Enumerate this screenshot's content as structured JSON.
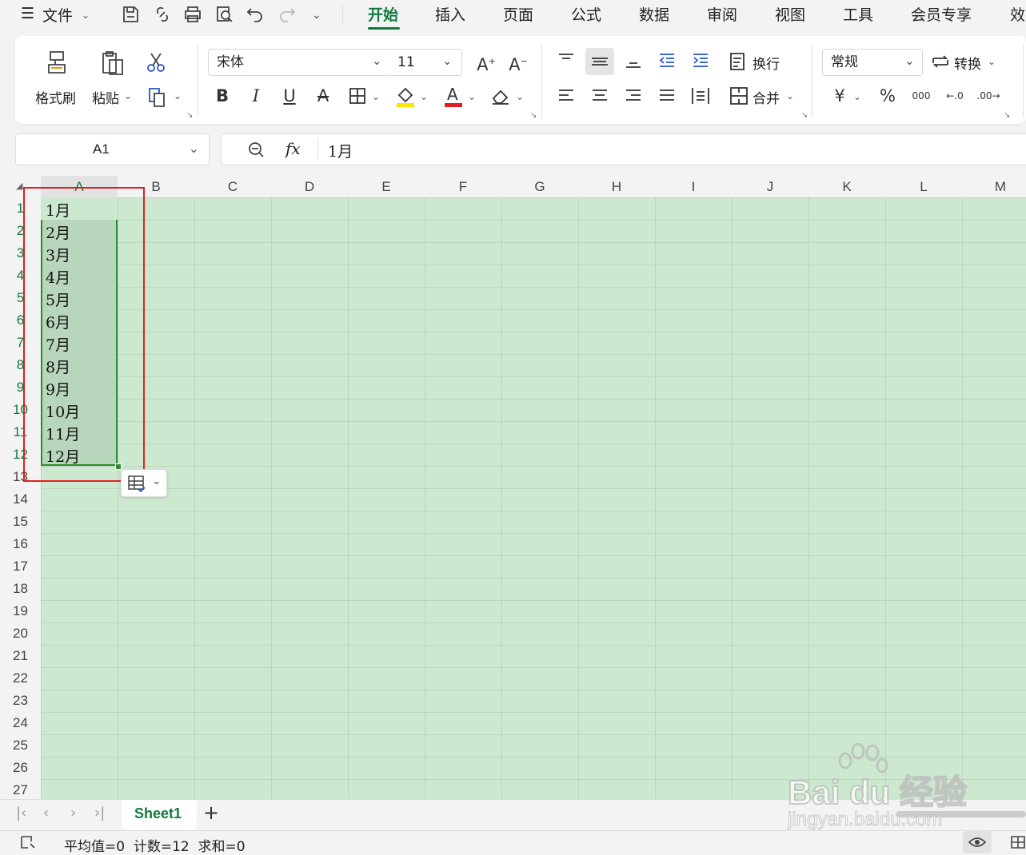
{
  "menubar": {
    "file_label": "文件",
    "tabs": [
      "开始",
      "插入",
      "页面",
      "公式",
      "数据",
      "审阅",
      "视图",
      "工具",
      "会员专享",
      "效"
    ]
  },
  "ribbon": {
    "format_painter": "格式刷",
    "paste": "粘贴",
    "font_name": "宋体",
    "font_size": "11",
    "wrap": "换行",
    "merge": "合并",
    "number_format": "常规",
    "convert": "转换"
  },
  "formula_bar": {
    "name_box": "A1",
    "fx": "fx",
    "content": "1月"
  },
  "grid": {
    "columns": [
      "A",
      "B",
      "C",
      "D",
      "E",
      "F",
      "G",
      "H",
      "I",
      "J",
      "K",
      "L",
      "M"
    ],
    "rows": [
      "1",
      "2",
      "3",
      "4",
      "5",
      "6",
      "7",
      "8",
      "9",
      "10",
      "11",
      "12",
      "13",
      "14",
      "15",
      "16",
      "17",
      "18",
      "19",
      "20",
      "21",
      "22",
      "23",
      "24",
      "25",
      "26",
      "27"
    ],
    "col_a_values": [
      "1月",
      "2月",
      "3月",
      "4月",
      "5月",
      "6月",
      "7月",
      "8月",
      "9月",
      "10月",
      "11月",
      "12月"
    ]
  },
  "sheets": {
    "active": "Sheet1",
    "add": "+"
  },
  "status": {
    "summary": "平均值=0  计数=12  求和=0"
  },
  "watermark": {
    "text": "Bai du 经验",
    "url": "jingyan.baidu.com"
  },
  "colors": {
    "accent": "#0f7b3f",
    "grid_bg": "#cce8cf",
    "selection_border": "#2e8b2e",
    "annotation": "#e02020"
  }
}
